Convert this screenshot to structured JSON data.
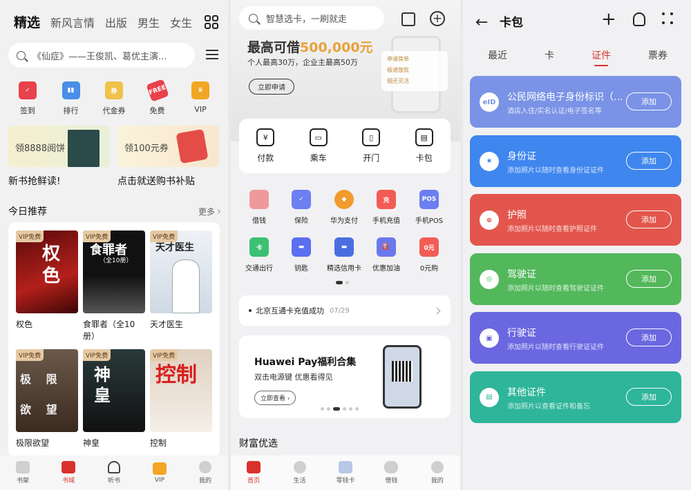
{
  "reader": {
    "tabs": [
      "精选",
      "新风言情",
      "出版",
      "男生",
      "女生"
    ],
    "search": "《仙症》——王俊凯、葛优主演...",
    "quick": [
      "签到",
      "排行",
      "代金券",
      "免费",
      "VIP"
    ],
    "banners": [
      {
        "text": "领8888阅饼",
        "caption": "新书抢鲜读!"
      },
      {
        "text": "领100元券",
        "caption": "点击就送购书补贴"
      }
    ],
    "rec_title": "今日推荐",
    "more": "更多",
    "badge": "VIP免费",
    "books": [
      {
        "title": "权色",
        "cover": "权色"
      },
      {
        "title": "食罪者（全10册）",
        "cover": "食罪者",
        "cover_sub": "（全10册）"
      },
      {
        "title": "天才医生",
        "cover": "天才医生"
      },
      {
        "title": "极限欲望",
        "cover": "极 限 欲 望"
      },
      {
        "title": "神皇",
        "cover": "神皇"
      },
      {
        "title": "控制",
        "cover": "控制"
      }
    ],
    "nav": [
      "书架",
      "书城",
      "听书",
      "VIP",
      "我的"
    ]
  },
  "wallet": {
    "search": "智慧选卡，一刷就走",
    "headline": "最高可借",
    "amount": "500,000元",
    "sub": "个人最高30万，企业主最高50万",
    "apply": "立即申请",
    "features": [
      "申请简单",
      "极速放款",
      "偿还灵活"
    ],
    "pay": [
      "付款",
      "乘车",
      "开门",
      "卡包"
    ],
    "pay_glyphs": [
      "¥",
      "▭",
      "▯",
      "▤"
    ],
    "services": [
      "借钱",
      "保险",
      "华为支付",
      "手机充值",
      "手机POS",
      "交通出行",
      "钥匙",
      "精选信用卡",
      "优惠加油",
      "0元购"
    ],
    "service_glyphs": [
      "",
      "✓",
      "◆",
      "充",
      "POS",
      "卡",
      "▬",
      "▬",
      "⛽",
      "0元"
    ],
    "notice": "北京互通卡充值成功",
    "notice_date": "07/29",
    "promo_title": "Huawei Pay福利合集",
    "promo_sub": "双击电源键 优惠看得见",
    "promo_btn": "立即查看 ›",
    "wealth": "财富优选",
    "nav": [
      "首页",
      "生活",
      "零钱卡",
      "借钱",
      "我的"
    ]
  },
  "cards": {
    "back": "←",
    "title": "卡包",
    "tabs": [
      "最近",
      "卡",
      "证件",
      "票券"
    ],
    "add": "添加",
    "items": [
      {
        "title": "公民网络电子身份标识（...",
        "sub": "酒店入住/实名认证/电子签名等",
        "icon": "eID"
      },
      {
        "title": "身份证",
        "sub": "添加照片以随时查看身份证证件",
        "icon": "★"
      },
      {
        "title": "护照",
        "sub": "添加照片以随时查看护照证件",
        "icon": "⊕"
      },
      {
        "title": "驾驶证",
        "sub": "添加照片以随时查看驾驶证证件",
        "icon": "◎"
      },
      {
        "title": "行驶证",
        "sub": "添加照片以随时查看行驶证证件",
        "icon": "▣"
      },
      {
        "title": "其他证件",
        "sub": "添加照片以查看证件和备忘",
        "icon": "▤"
      }
    ],
    "colors": [
      "#7a93e6",
      "#3f86ee",
      "#e2564d",
      "#52b85b",
      "#6b67e0",
      "#2eb59a"
    ]
  }
}
